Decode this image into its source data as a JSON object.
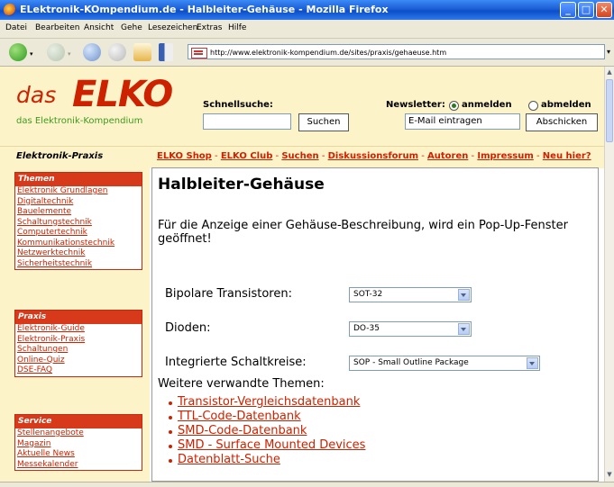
{
  "window": {
    "title": "ELektronik-KOmpendium.de - Halbleiter-Gehäuse - Mozilla Firefox",
    "min": "_",
    "max": "□",
    "close": "✕"
  },
  "menu": [
    "Datei",
    "Bearbeiten",
    "Ansicht",
    "Gehe",
    "Lesezeichen",
    "Extras",
    "Hilfe"
  ],
  "nav": {
    "url": "http://www.elektronik-kompendium.de/sites/praxis/gehaeuse.htm",
    "icons": [
      "back-icon",
      "forward-icon",
      "reload-icon",
      "stop-icon",
      "home-icon",
      "bookmarks-icon"
    ]
  },
  "header": {
    "logo_das": "das",
    "logo_elko": "ELKO",
    "logo_sub": "das Elektronik-Kompendium",
    "search_label": "Schnellsuche:",
    "search_button": "Suchen",
    "newsletter_label": "Newsletter:",
    "subscribe": "anmelden",
    "unsubscribe": "abmelden",
    "email_placeholder": "E-Mail eintragen",
    "submit_button": "Abschicken"
  },
  "subheader": {
    "section": "Elektronik-Praxis",
    "links": [
      "ELKO Shop",
      "ELKO Club",
      "Suchen",
      "Diskussionsforum",
      "Autoren",
      "Impressum",
      "Neu hier?"
    ],
    "separator": "-"
  },
  "sidebar": {
    "themen": {
      "title": "Themen",
      "items": [
        "Elektronik Grundlagen",
        "Digitaltechnik",
        "Bauelemente",
        "Schaltungstechnik",
        "Computertechnik",
        "Kommunikationstechnik",
        "Netzwerktechnik",
        "Sicherheitstechnik"
      ]
    },
    "praxis": {
      "title": "Praxis",
      "items": [
        "Elektronik-Guide",
        "Elektronik-Praxis",
        "Schaltungen",
        "Online-Quiz",
        "DSE-FAQ"
      ]
    },
    "service": {
      "title": "Service",
      "items": [
        "Stellenangebote",
        "Magazin",
        "Aktuelle News",
        "Messekalender"
      ]
    }
  },
  "main": {
    "title": "Halbleiter-Gehäuse",
    "intro": "Für die Anzeige einer Gehäuse-Beschreibung, wird ein Pop-Up-Fenster geöffnet!",
    "fields": [
      {
        "label": "Bipolare Transistoren:",
        "value": "SOT-32"
      },
      {
        "label": "Dioden:",
        "value": "DO-35"
      },
      {
        "label": "Integrierte Schaltkreise:",
        "value": "SOP - Small Outline Package"
      }
    ],
    "related_title": "Weitere verwandte Themen:",
    "related": [
      "Transistor-Vergleichsdatenbank",
      "TTL-Code-Datenbank",
      "SMD-Code-Datenbank",
      "SMD - Surface Mounted Devices",
      "Datenblatt-Suche"
    ]
  },
  "status": ""
}
